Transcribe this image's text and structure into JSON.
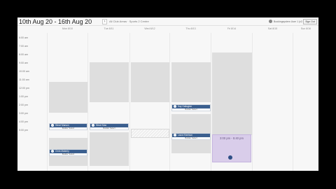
{
  "header": {
    "week_range": "10th Aug 20 - 16th Aug 20",
    "nav_prev": "‹",
    "nav_next": "›",
    "filter_text": "All Club Areas · Sports 2 Centre",
    "user": "Bookingsystem User 1 (v2.4.8)",
    "logout": "Sign Out"
  },
  "days": [
    "Mon 8/10",
    "Tue 8/11",
    "Wed 8/12",
    "Thu 8/13",
    "Fri 8/14",
    "Sat 8/15",
    "Sun 8/16"
  ],
  "hours": [
    "6:00 am",
    "7:00 am",
    "8:00 am",
    "9:00 am",
    "10:00 am",
    "11:00 am",
    "12:00 pm",
    "1:00 pm",
    "2:00 pm",
    "3:00 pm",
    "4:00 pm",
    "5:00 pm"
  ],
  "bookings": [
    {
      "name": "Steve Marson",
      "sub": "Builder Select"
    },
    {
      "name": "Steve Max",
      "sub": "Builder Select"
    },
    {
      "name": "Kay Gallagher",
      "sub": "Builder Select"
    },
    {
      "name": "Chris Maberly",
      "sub": "Builder Select"
    },
    {
      "name": "Laura Harrison",
      "sub": "Builder Select"
    }
  ],
  "selection": {
    "time_range": "3:00 pm - 5:40 pm"
  },
  "colors": {
    "booking_header": "#3b5f8f",
    "selection": "#d9cdea",
    "unavailable": "#dedede"
  }
}
